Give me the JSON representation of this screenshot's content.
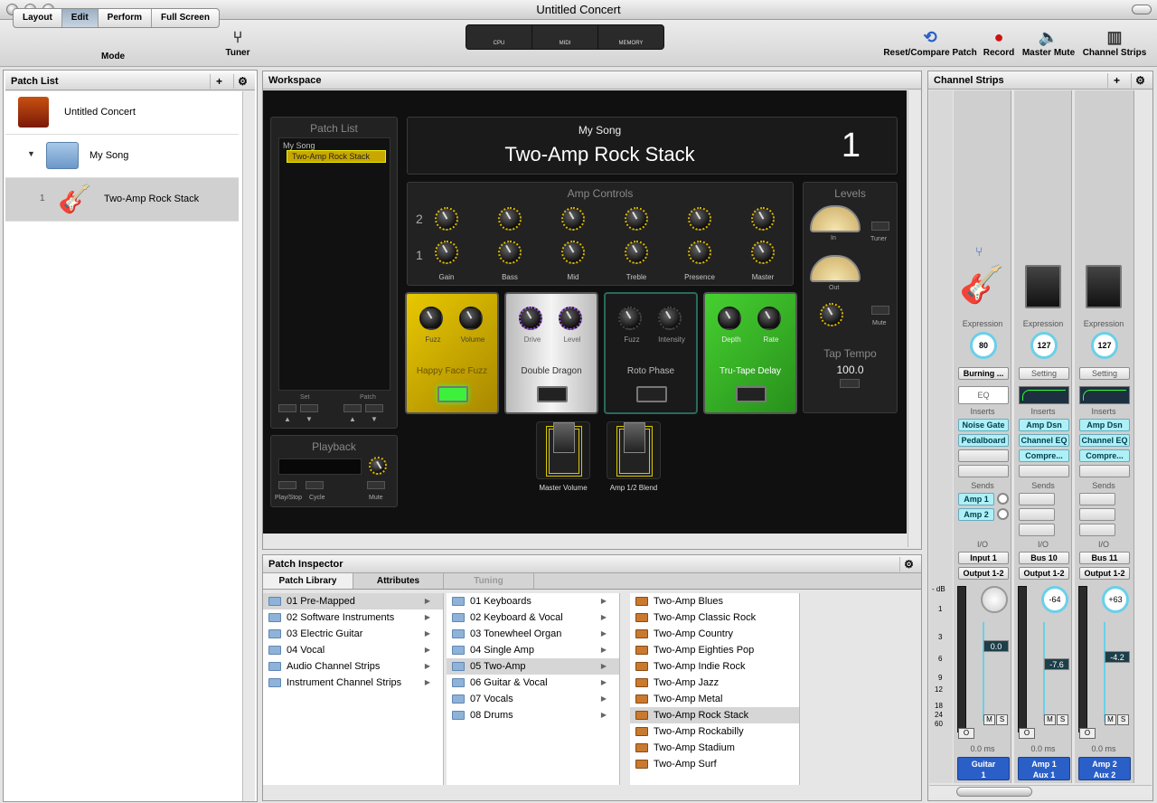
{
  "window": {
    "title": "Untitled Concert"
  },
  "toolbar": {
    "modes": [
      "Layout",
      "Edit",
      "Perform",
      "Full Screen"
    ],
    "mode_label": "Mode",
    "tuner": "Tuner",
    "meters": [
      "CPU",
      "MIDI",
      "MEMORY"
    ],
    "reset": "Reset/Compare Patch",
    "record": "Record",
    "master_mute": "Master Mute",
    "channel_strips": "Channel Strips"
  },
  "patch_list": {
    "title": "Patch List",
    "concert": "Untitled Concert",
    "song": "My Song",
    "patch_num": "1",
    "patch": "Two-Amp Rock Stack"
  },
  "workspace": {
    "title": "Workspace",
    "pl_title": "Patch List",
    "pl_song": "My Song",
    "pl_patch": "Two-Amp Rock Stack",
    "set": "Set",
    "patch": "Patch",
    "playback": "Playback",
    "play_stop": "Play/Stop",
    "cycle": "Cycle",
    "mute": "Mute",
    "song": "My Song",
    "patch_name": "Two-Amp Rock Stack",
    "patch_num": "1",
    "amp_controls": "Amp Controls",
    "row2": "2",
    "row1": "1",
    "amp_knobs": [
      "Gain",
      "Bass",
      "Mid",
      "Treble",
      "Presence",
      "Master"
    ],
    "levels": "Levels",
    "in": "In",
    "out": "Out",
    "tuner": "Tuner",
    "mute2": "Mute",
    "tap_tempo": "Tap Tempo",
    "tempo": "100.0",
    "pedals": [
      {
        "name": "Happy Face Fuzz",
        "k1": "Fuzz",
        "k2": "Volume",
        "color": "#d8b400"
      },
      {
        "name": "Double Dragon",
        "k1": "Drive",
        "k2": "Level",
        "color": "#d8d8d8"
      },
      {
        "name": "Roto Phase",
        "k1": "Fuzz",
        "k2": "Intensity",
        "color": "#1c1c1c"
      },
      {
        "name": "Tru-Tape Delay",
        "k1": "Depth",
        "k2": "Rate",
        "color": "#3cb828"
      }
    ],
    "exp1": "Master Volume",
    "exp2": "Amp 1/2 Blend"
  },
  "inspector": {
    "title": "Patch Inspector",
    "tabs": [
      "Patch Library",
      "Attributes",
      "Tuning"
    ],
    "col1": [
      "01 Pre-Mapped",
      "02 Software Instruments",
      "03 Electric Guitar",
      "04 Vocal",
      "Audio Channel Strips",
      "Instrument Channel Strips"
    ],
    "col2": [
      "01 Keyboards",
      "02 Keyboard & Vocal",
      "03 Tonewheel Organ",
      "04 Single Amp",
      "05 Two-Amp",
      "06 Guitar & Vocal",
      "07 Vocals",
      "08 Drums"
    ],
    "col3": [
      "Two-Amp Blues",
      "Two-Amp Classic Rock",
      "Two-Amp Country",
      "Two-Amp Eighties Pop",
      "Two-Amp Indie Rock",
      "Two-Amp Jazz",
      "Two-Amp Metal",
      "Two-Amp Rock Stack",
      "Two-Amp Rockabilly",
      "Two-Amp Stadium",
      "Two-Amp Surf"
    ]
  },
  "channel_strips": {
    "title": "Channel Strips",
    "db": "- dB",
    "scale": [
      "1",
      "3",
      "6",
      "9",
      "12",
      "18",
      "24",
      "60"
    ],
    "strips": [
      {
        "expression": "Expression",
        "exp_val": "80",
        "plugin": "Burning ...",
        "eq": "EQ",
        "inserts": "Inserts",
        "ins": [
          "Noise Gate",
          "Pedalboard"
        ],
        "sends": "Sends",
        "snd": [
          "Amp 1",
          "Amp 2"
        ],
        "io": "I/O",
        "input": "Input 1",
        "output": "Output 1-2",
        "pan": "",
        "fader": "0.0",
        "m": "M",
        "s": "S",
        "o": "O",
        "delay": "0.0 ms",
        "name1": "Guitar",
        "name2": "1"
      },
      {
        "expression": "Expression",
        "exp_val": "127",
        "plugin": "Setting",
        "eq": "",
        "inserts": "Inserts",
        "ins": [
          "Amp Dsn",
          "Channel EQ",
          "Compre..."
        ],
        "sends": "Sends",
        "snd": [],
        "io": "I/O",
        "input": "Bus 10",
        "output": "Output 1-2",
        "pan": "-64",
        "fader": "-7.6",
        "m": "M",
        "s": "S",
        "o": "O",
        "delay": "0.0 ms",
        "name1": "Amp 1",
        "name2": "Aux 1"
      },
      {
        "expression": "Expression",
        "exp_val": "127",
        "plugin": "Setting",
        "eq": "",
        "inserts": "Inserts",
        "ins": [
          "Amp Dsn",
          "Channel EQ",
          "Compre..."
        ],
        "sends": "Sends",
        "snd": [],
        "io": "I/O",
        "input": "Bus 11",
        "output": "Output 1-2",
        "pan": "+63",
        "fader": "-4.2",
        "m": "M",
        "s": "S",
        "o": "O",
        "delay": "0.0 ms",
        "name1": "Amp 2",
        "name2": "Aux 2"
      }
    ]
  }
}
